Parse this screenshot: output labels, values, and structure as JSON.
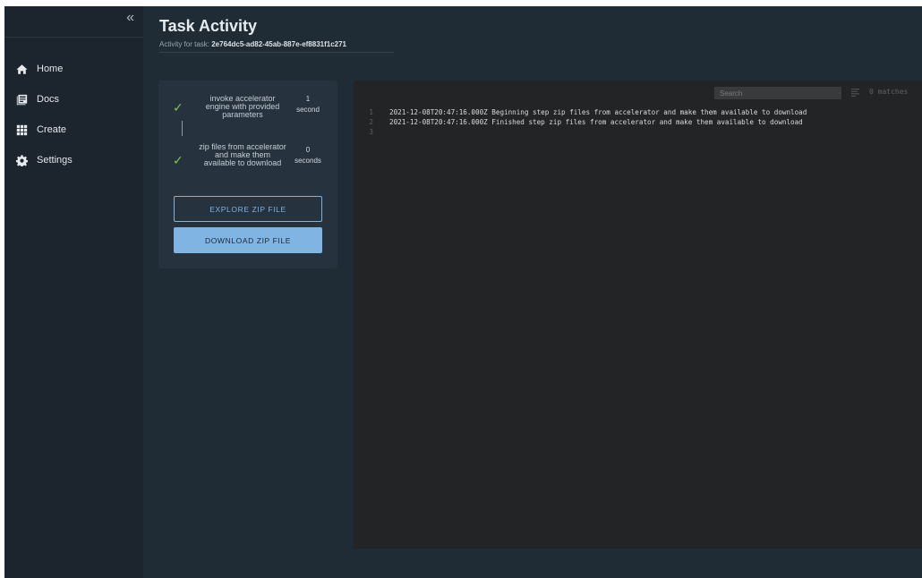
{
  "sidebar": {
    "collapse_icon": "«",
    "items": [
      {
        "label": "Home",
        "icon": "home-icon"
      },
      {
        "label": "Docs",
        "icon": "docs-icon"
      },
      {
        "label": "Create",
        "icon": "grid-icon"
      },
      {
        "label": "Settings",
        "icon": "gear-icon"
      }
    ]
  },
  "header": {
    "title": "Task Activity",
    "subtitle_prefix": "Activity for task: ",
    "task_id": "2e764dc5-ad82-45ab-887e-ef8831f1c271"
  },
  "steps": [
    {
      "status": "complete",
      "label": "invoke accelerator engine with provided parameters",
      "duration_value": "1",
      "duration_unit": "second"
    },
    {
      "status": "complete",
      "label": "zip files from accelerator and make them available to download",
      "duration_value": "0",
      "duration_unit": "seconds"
    }
  ],
  "buttons": {
    "explore": "EXPLORE ZIP FILE",
    "download": "DOWNLOAD ZIP FILE"
  },
  "log": {
    "search_placeholder": "Search",
    "matches": "0 matches",
    "lines": [
      {
        "num": "1",
        "text": "2021-12-08T20:47:16.000Z Beginning step zip files from accelerator and make them available to download"
      },
      {
        "num": "2",
        "text": "2021-12-08T20:47:16.000Z Finished step zip files from accelerator and make them available to download"
      },
      {
        "num": "3",
        "text": ""
      }
    ]
  },
  "colors": {
    "accent": "#7fb4e3",
    "success": "#86c34a",
    "sidebar_bg": "#1c252e",
    "main_bg": "#1f2b35",
    "log_bg": "#232425"
  }
}
